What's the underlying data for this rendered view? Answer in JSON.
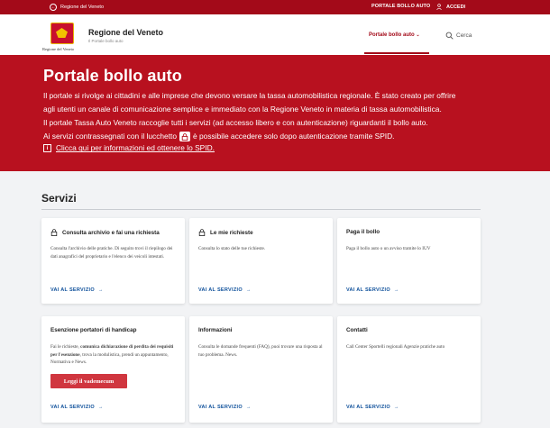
{
  "topbar": {
    "region_link": "Regione del Veneto",
    "portal_link": "PORTALE BOLLO AUTO",
    "login": "ACCEDI"
  },
  "header": {
    "logo_text": "Regione del Veneto",
    "title": "Regione del Veneto",
    "subtitle": "Il Portale bollo auto",
    "nav_item": "Portale bollo auto",
    "search": "Cerca"
  },
  "hero": {
    "title": "Portale bollo auto",
    "p1": "Il portale si rivolge ai cittadini e alle imprese che devono versare la tassa automobilistica regionale. È stato creato per offrire",
    "p2": "agli utenti un canale di comunicazione semplice e immediato con la Regione Veneto in materia di tassa automobilistica.",
    "p3": "Il portale Tassa Auto Veneto raccoglie tutti i servizi (ad accesso libero e con autenticazione) riguardanti il bollo auto.",
    "p4_before": "Ai servizi contrassegnati con il lucchetto",
    "p4_after": "è possibile accedere solo dopo autenticazione tramite SPID.",
    "spid_link": "Clicca qui per informazioni ed ottenere lo SPID."
  },
  "services": {
    "title": "Servizi",
    "link_label": "VAI AL SERVIZIO",
    "cards": [
      {
        "title": "Consulta archivio e fai una richiesta",
        "locked": true,
        "text": "Consulta l'archivio delle pratiche. Di seguito trovi il riepilogo dei dati anagrafici del proprietario e l'elenco dei veicoli intestati."
      },
      {
        "title": "Le mie richieste",
        "locked": true,
        "text": "Consulta lo stato delle tue richieste."
      },
      {
        "title": "Paga il bollo",
        "locked": false,
        "text": "Paga il bollo auto o un avviso tramite lo IUV"
      },
      {
        "title": "Esenzione portatori di handicap",
        "locked": false,
        "text_pre": "Fai le richieste, ",
        "text_bold": "comunica dichiarazione di perdita dei requisiti per l'esenzione",
        "text_post": ", trova la modulistica, prendi un appuntamento, Normativa e News.",
        "button": "Leggi il vademecum"
      },
      {
        "title": "Informazioni",
        "locked": false,
        "text": "Consulta le domande frequenti (FAQ), puoi trovare una risposta al tuo problema. News."
      },
      {
        "title": "Contatti",
        "locked": false,
        "text": "Call Center Sportelli regionali Agenzie pratiche auto"
      }
    ]
  },
  "colors": {
    "brand_red": "#b8111f",
    "topbar_red": "#a30a19",
    "link_blue": "#0d4f9a",
    "button_red": "#d0363f"
  }
}
